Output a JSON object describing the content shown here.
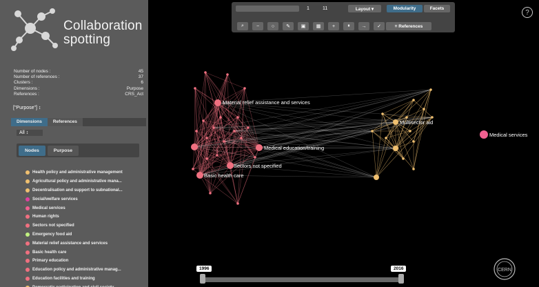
{
  "app": {
    "logo_line1": "Collaboration",
    "logo_line2": "spotting"
  },
  "stats": [
    {
      "label": "Number of nodes :",
      "value": "45"
    },
    {
      "label": "Number of references :",
      "value": "37"
    },
    {
      "label": "Clusters :",
      "value": "6"
    },
    {
      "label": "Dimensions :",
      "value": "Purpose"
    },
    {
      "label": "References :",
      "value": "CRS_Act"
    }
  ],
  "purpose_select": "[\"Purpose\"] ↕",
  "tabs": {
    "dimensions": "Dimensions",
    "references": "References"
  },
  "filter_select": "All ↕",
  "subtabs": {
    "nodes": "Nodes",
    "purpose": "Purpose"
  },
  "node_list": [
    {
      "label": "Health policy and administrative management",
      "color": "#f0c070"
    },
    {
      "label": "Agricultural policy and administrative mana...",
      "color": "#f0c070"
    },
    {
      "label": "Decentralisation and support to subnational...",
      "color": "#f0c070"
    },
    {
      "label": "Social/welfare services",
      "color": "#e040a0"
    },
    {
      "label": "Medical services",
      "color": "#f06090"
    },
    {
      "label": "Human rights",
      "color": "#f07080"
    },
    {
      "label": "Sectors not specified",
      "color": "#f07080"
    },
    {
      "label": "Emergency food aid",
      "color": "#c0f080"
    },
    {
      "label": "Material relief assistance and services",
      "color": "#f07080"
    },
    {
      "label": "Basic health care",
      "color": "#f07080"
    },
    {
      "label": "Primary education",
      "color": "#f07080"
    },
    {
      "label": "Education policy and administrative manag...",
      "color": "#f07080"
    },
    {
      "label": "Education facilities and training",
      "color": "#f07080"
    },
    {
      "label": "Democratic participation and civil society",
      "color": "#f0c070"
    }
  ],
  "toolbar": {
    "range_start": "1",
    "range_end": "11",
    "layout": "Layout ▾",
    "modularity": "Modularity",
    "facets": "Facets",
    "references": "≡ References",
    "icons": [
      "search-icon",
      "minus-icon",
      "circle-icon",
      "pencil-icon",
      "image-icon",
      "grid-icon",
      "plus-icon",
      "pause-icon",
      "arrow-right-icon",
      "check-icon"
    ],
    "icon_glyphs": [
      "⌕",
      "−",
      "○",
      "✎",
      "▣",
      "▦",
      "+",
      "⏸",
      "→",
      "✓"
    ]
  },
  "help": "?",
  "graph": {
    "labels": {
      "material": "Material relief assistance and services",
      "medical_edu": "Medical education/training",
      "sectors": "Sectors not specified",
      "basic": "Basic health care",
      "multisector": "Multisector aid",
      "medical_services": "Medical services"
    },
    "colors": {
      "pink": "#f07080",
      "orange": "#f0c070",
      "medical": "#f06090",
      "edge": "#cccccc"
    }
  },
  "timeline": {
    "start_year": "1996",
    "end_year": "2016"
  },
  "cern": "CERN"
}
